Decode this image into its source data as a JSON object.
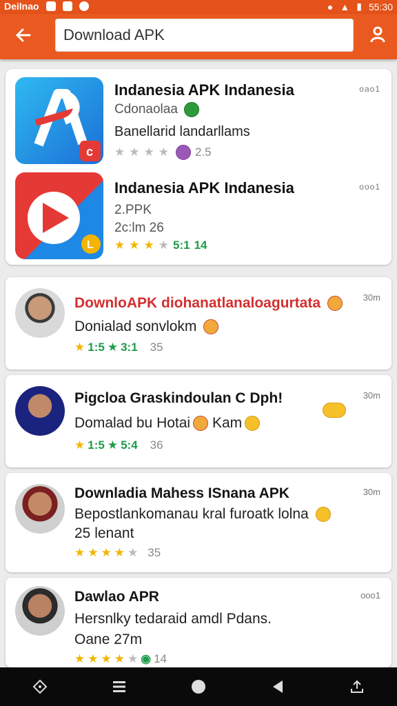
{
  "status": {
    "carrier": "Deilnao",
    "time": "55:30"
  },
  "search": {
    "value": "Download APK",
    "placeholder": "Download APK"
  },
  "apps": [
    {
      "title": "Indanesia APK Indanesia",
      "meta": "Cdonaolaa",
      "sub": "Banellarid landarllams",
      "rating": "2.5",
      "dots": "oao1"
    },
    {
      "title": "Indanesia APK Indanesia",
      "meta": "2.PPK",
      "sub": "2c:lm 26",
      "rating": "5:1",
      "count": "14",
      "dots": "ooo1"
    }
  ],
  "reviews": [
    {
      "title": "DownloAPK diohanatlanaloagurtata",
      "line1": "Donialad sonvlokm",
      "time": "30m",
      "rating": "1:5",
      "score": "3:1",
      "count": "35"
    },
    {
      "title": "Pigcloa Graskindoulan C Dph!",
      "line1": "Domalad bu Hotai",
      "line1b": "Kam",
      "time": "30m",
      "rating": "1:5",
      "score": "5:4",
      "count": "36"
    },
    {
      "title": "Downladia Mahess ISnana APK",
      "line1": "Bepostlankomanau kral furoatk lolna",
      "line2": "25 lenant",
      "time": "30m",
      "count": "35"
    },
    {
      "title": "Dawlao APR",
      "line1": "Hersnlky tedaraid amdl Pdans.",
      "line2": "Oane 27m",
      "time": "ooo1",
      "count": "14"
    }
  ],
  "colors": {
    "toolbar": "#ea5a20",
    "accent_red": "#d32f2f",
    "star": "#f1b500",
    "green": "#1e9b4a"
  }
}
